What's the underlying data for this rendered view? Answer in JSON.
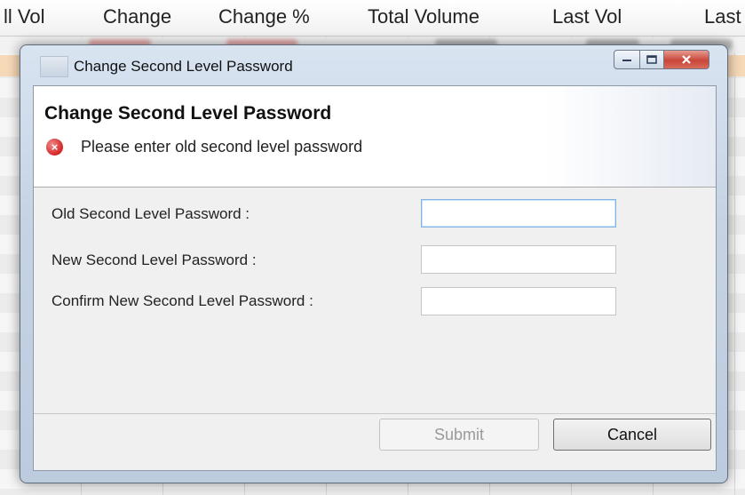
{
  "background": {
    "columns": [
      "ll Vol",
      "Change",
      "Change %",
      "Total Volume",
      "Last Vol",
      "Last"
    ]
  },
  "dialog": {
    "window_title": "Change Second Level Password",
    "header_title": "Change Second Level Password",
    "error_message": "Please enter old second level password",
    "fields": [
      {
        "label": "Old Second Level Password :",
        "value": "",
        "focused": true
      },
      {
        "label": "New Second Level Password :",
        "value": "",
        "focused": false
      },
      {
        "label": "Confirm New Second Level Password :",
        "value": "",
        "focused": false
      }
    ],
    "submit_label": "Submit",
    "cancel_label": "Cancel",
    "caption_buttons": {
      "minimize": "minimize-icon",
      "maximize": "maximize-icon",
      "close": "close-icon"
    }
  }
}
